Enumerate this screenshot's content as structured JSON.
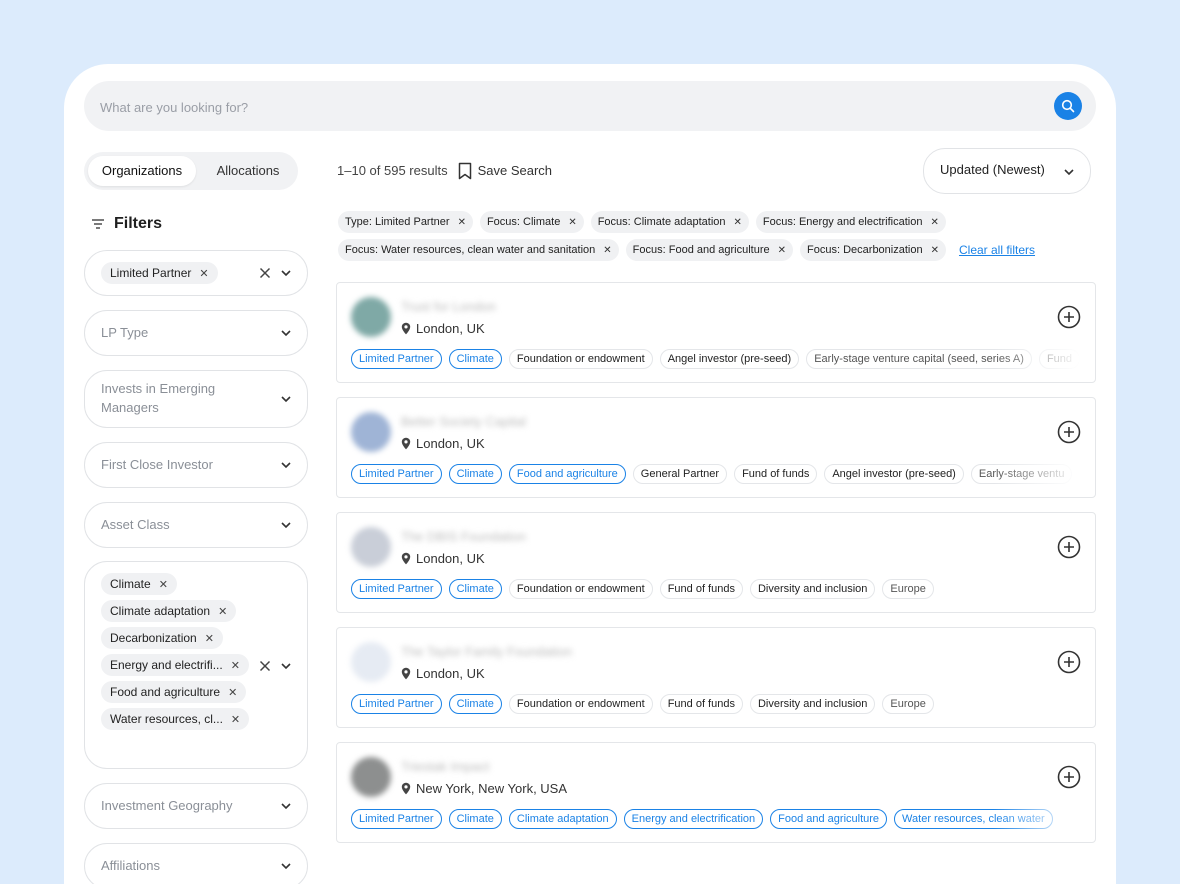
{
  "search": {
    "placeholder": "What are you looking for?"
  },
  "tabs": {
    "active": "Organizations",
    "other": "Allocations"
  },
  "filters": {
    "title": "Filters",
    "limited_partner_chip": "Limited Partner",
    "lp_type": "LP Type",
    "emerging_line1": "Invests in Emerging",
    "emerging_line2": "Managers",
    "first_close": "First Close Investor",
    "asset_class": "Asset Class",
    "focus_chips": [
      "Climate",
      "Climate adaptation",
      "Decarbonization",
      "Energy and electrifi...",
      "Food and agriculture",
      "Water resources, cl..."
    ],
    "investment_geography": "Investment Geography",
    "affiliations": "Affiliations"
  },
  "results": {
    "count": "1–10 of 595 results",
    "save_search": "Save Search",
    "sort": "Updated (Newest)",
    "active_filters_row1": [
      "Type: Limited Partner",
      "Focus: Climate",
      "Focus: Climate adaptation",
      "Focus: Energy and electrification"
    ],
    "active_filters_row2": [
      "Focus: Water resources, clean water and sanitation",
      "Focus: Food and agriculture",
      "Focus: Decarbonization"
    ],
    "clear_all": "Clear all filters"
  },
  "cards": [
    {
      "name": "Trust for London",
      "location": "London, UK",
      "logo_color": "#7fa9a6",
      "blue_tags": [
        "Limited Partner",
        "Climate"
      ],
      "tags": [
        "Foundation or endowment",
        "Angel investor (pre-seed)",
        "Early-stage venture capital (seed, series A)",
        "Fund"
      ]
    },
    {
      "name": "Better Society Capital",
      "location": "London, UK",
      "logo_color": "#9fb4d6",
      "blue_tags": [
        "Limited Partner",
        "Climate",
        "Food and agriculture"
      ],
      "tags": [
        "General Partner",
        "Fund of funds",
        "Angel investor (pre-seed)",
        "Early-stage ventu"
      ]
    },
    {
      "name": "The DBIS Foundation",
      "location": "London, UK",
      "logo_color": "#c9ced8",
      "blue_tags": [
        "Limited Partner",
        "Climate"
      ],
      "tags": [
        "Foundation or endowment",
        "Fund of funds",
        "Diversity and inclusion",
        "Europe"
      ]
    },
    {
      "name": "The Taylor Family Foundation",
      "location": "London, UK",
      "logo_color": "#e6ebf3",
      "blue_tags": [
        "Limited Partner",
        "Climate"
      ],
      "tags": [
        "Foundation or endowment",
        "Fund of funds",
        "Diversity and inclusion",
        "Europe"
      ]
    },
    {
      "name": "Triestak Impact",
      "location": "New York, New York, USA",
      "logo_color": "#8d8f8f",
      "blue_tags": [
        "Limited Partner",
        "Climate",
        "Climate adaptation",
        "Energy and electrification",
        "Food and agriculture",
        "Water resources, clean water"
      ],
      "tags": []
    }
  ],
  "colors": {
    "accent": "#1a82e6",
    "background": "#dcebfc"
  }
}
